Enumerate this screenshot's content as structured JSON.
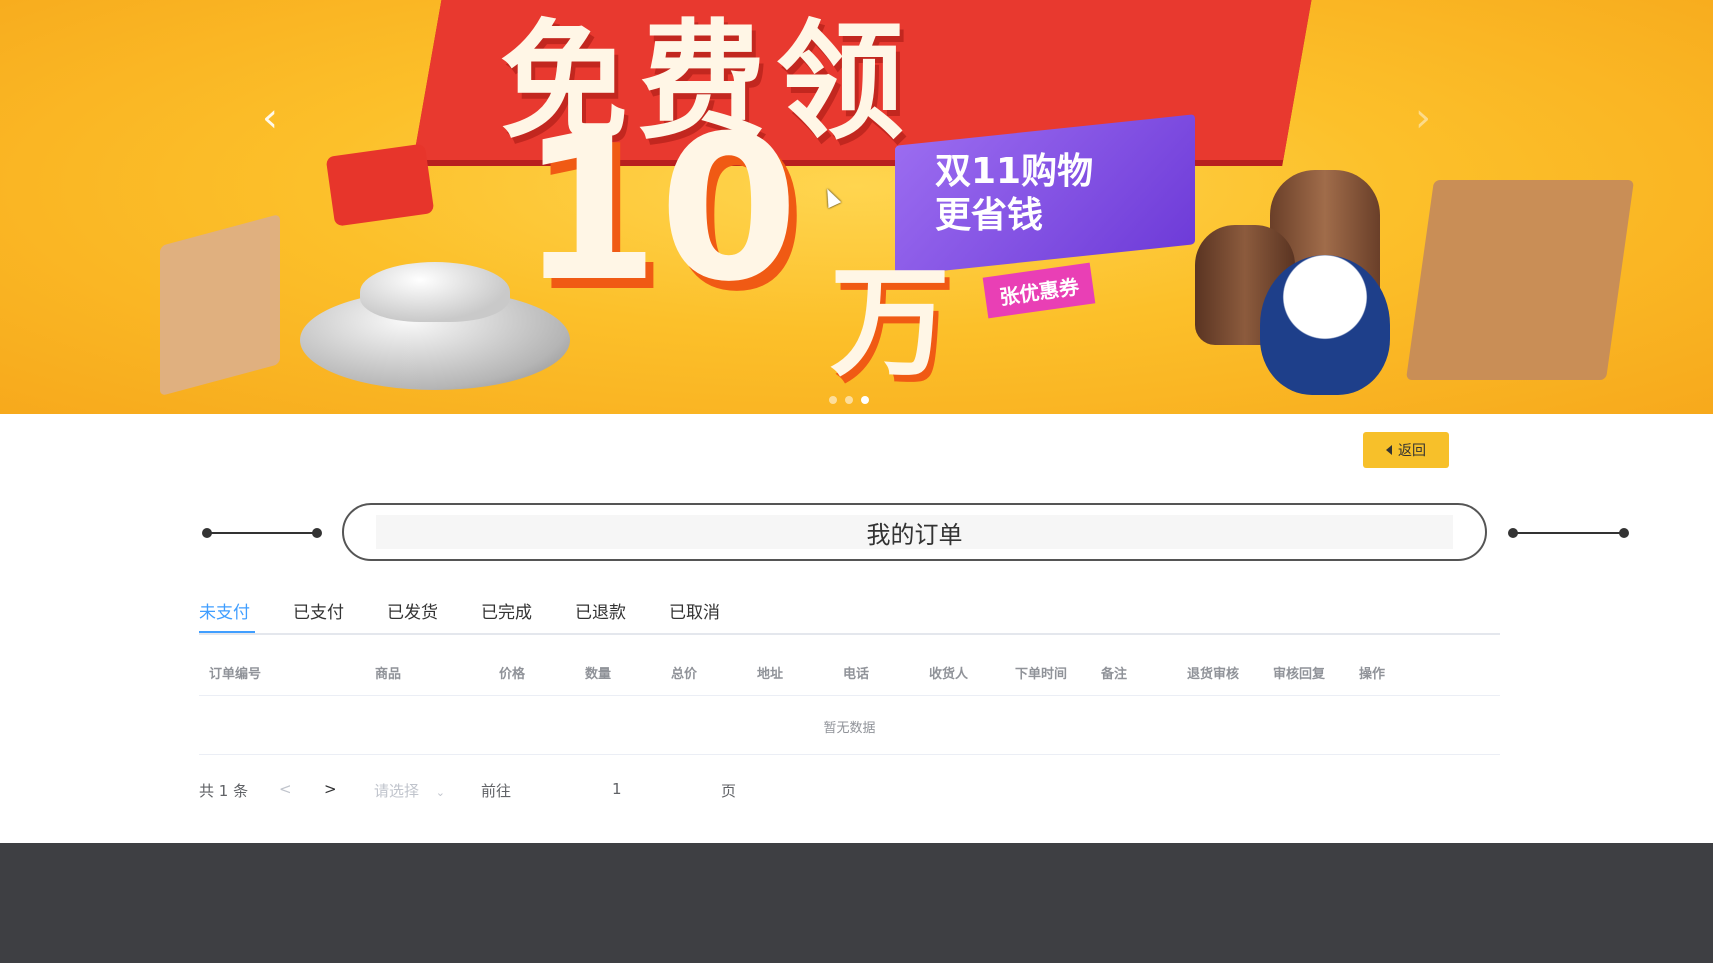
{
  "banner": {
    "headline": "免费领",
    "big_number": "10",
    "unit": "万",
    "promo_line1": "双11购物",
    "promo_line2": "更省钱",
    "coupon": "张优惠券",
    "prev_arrow": "‹",
    "next_arrow": "›",
    "slides_total": 3,
    "active_slide": 3
  },
  "back_button": {
    "label": "返回",
    "icon": "caret-left-icon"
  },
  "page_title": "我的订单",
  "tabs": [
    {
      "label": "未支付",
      "active": true
    },
    {
      "label": "已支付"
    },
    {
      "label": "已发货"
    },
    {
      "label": "已完成"
    },
    {
      "label": "已退款"
    },
    {
      "label": "已取消"
    }
  ],
  "table": {
    "columns": [
      "订单编号",
      "商品",
      "价格",
      "数量",
      "总价",
      "地址",
      "电话",
      "收货人",
      "下单时间",
      "备注",
      "退货审核",
      "审核回复",
      "操作"
    ],
    "empty_text": "暂无数据"
  },
  "pagination": {
    "total": "共 1 条",
    "prev": "<",
    "next": ">",
    "page_size_placeholder": "请选择",
    "goto_label": "前往",
    "goto_value": "1",
    "page_suffix": "页"
  },
  "colors": {
    "accent": "#409eff",
    "button_yellow": "#f7c02a",
    "footer": "#3e3f43",
    "banner_bg": "#fcc02a"
  }
}
